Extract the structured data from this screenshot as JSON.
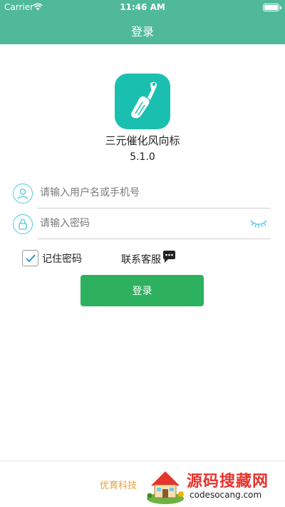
{
  "status_bar": {
    "carrier": "Carrier",
    "time": "11:46 AM"
  },
  "nav": {
    "title": "登录"
  },
  "app": {
    "name": "三元催化风向标",
    "version": "5.1.0"
  },
  "username": {
    "placeholder": "请输入用户名或手机号",
    "value": ""
  },
  "password": {
    "placeholder": "请输入密码",
    "value": ""
  },
  "remember": {
    "label": "记住密码",
    "checked": true
  },
  "contact": {
    "label": "联系客服"
  },
  "login_button": {
    "label": "登录"
  },
  "footer": {
    "company": "优育科技"
  },
  "watermark": {
    "title": "源码搜藏网",
    "url": "codesocang.com"
  },
  "colors": {
    "header": "#4fb998",
    "logo": "#1bbfb0",
    "button": "#2eb15e",
    "field_icon": "#4ec8e0",
    "company": "#e6a33e",
    "watermark": "#e8322c"
  },
  "icons": {
    "username_field": "user-icon",
    "password_field": "lock-icon",
    "password_toggle": "eye-closed-icon",
    "contact": "chat-bubble-icon",
    "remember": "checkmark-icon"
  }
}
